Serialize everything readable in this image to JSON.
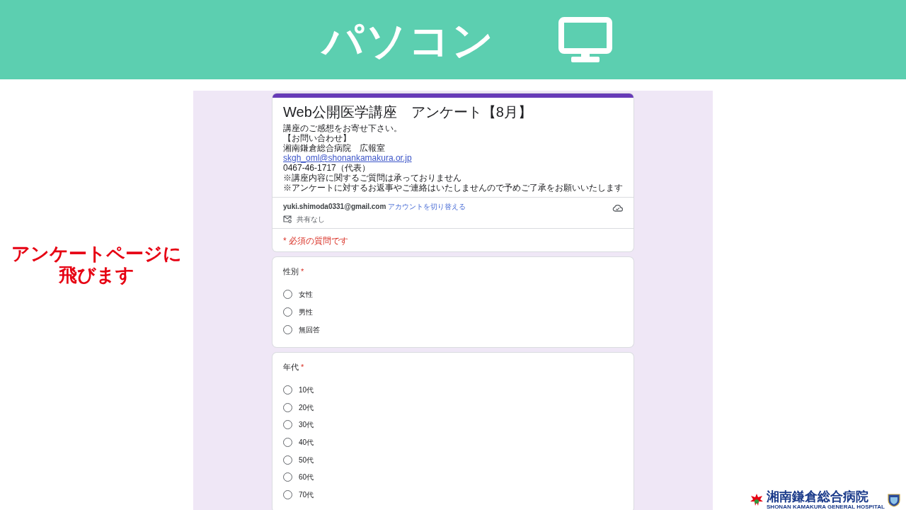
{
  "slide": {
    "title": "パソコン",
    "caption": [
      "アンケートページに",
      "飛びます"
    ]
  },
  "form": {
    "title": "Web公開医学講座　アンケート【8月】",
    "description": [
      {
        "kind": "text",
        "text": "講座のご感想をお寄せ下さい。"
      },
      {
        "kind": "text",
        "text": "【お問い合わせ】"
      },
      {
        "kind": "text",
        "text": "湘南鎌倉総合病院　広報室"
      },
      {
        "kind": "link",
        "text": "skgh_oml@shonankamakura.or.jp"
      },
      {
        "kind": "text",
        "text": "0467-46-1717（代表）"
      },
      {
        "kind": "text",
        "text": "※講座内容に関するご質問は承っておりません"
      },
      {
        "kind": "text",
        "text": "※アンケートに対するお返事やご連絡はいたしませんので予めご了承をお願いいたします"
      }
    ],
    "account": {
      "email": "yuki.shimoda0331@gmail.com",
      "switch_link": "アカウントを切り替える",
      "sharing": "共有なし"
    },
    "required_note": "* 必須の質問です",
    "questions": [
      {
        "title": "性別",
        "required_mark": "*",
        "options": [
          {
            "label": "女性",
            "selected": false
          },
          {
            "label": "男性",
            "selected": false
          },
          {
            "label": "無回答",
            "selected": false
          }
        ]
      },
      {
        "title": "年代",
        "required_mark": "*",
        "options": [
          {
            "label": "10代",
            "selected": false
          },
          {
            "label": "20代",
            "selected": false
          },
          {
            "label": "30代",
            "selected": false
          },
          {
            "label": "40代",
            "selected": false
          },
          {
            "label": "50代",
            "selected": false
          },
          {
            "label": "60代",
            "selected": false
          },
          {
            "label": "70代",
            "selected": false
          }
        ]
      }
    ]
  },
  "logo": {
    "name": "湘南鎌倉総合病院",
    "name_en": "SHONAN KAMAKURA GENERAL HOSPITAL"
  }
}
